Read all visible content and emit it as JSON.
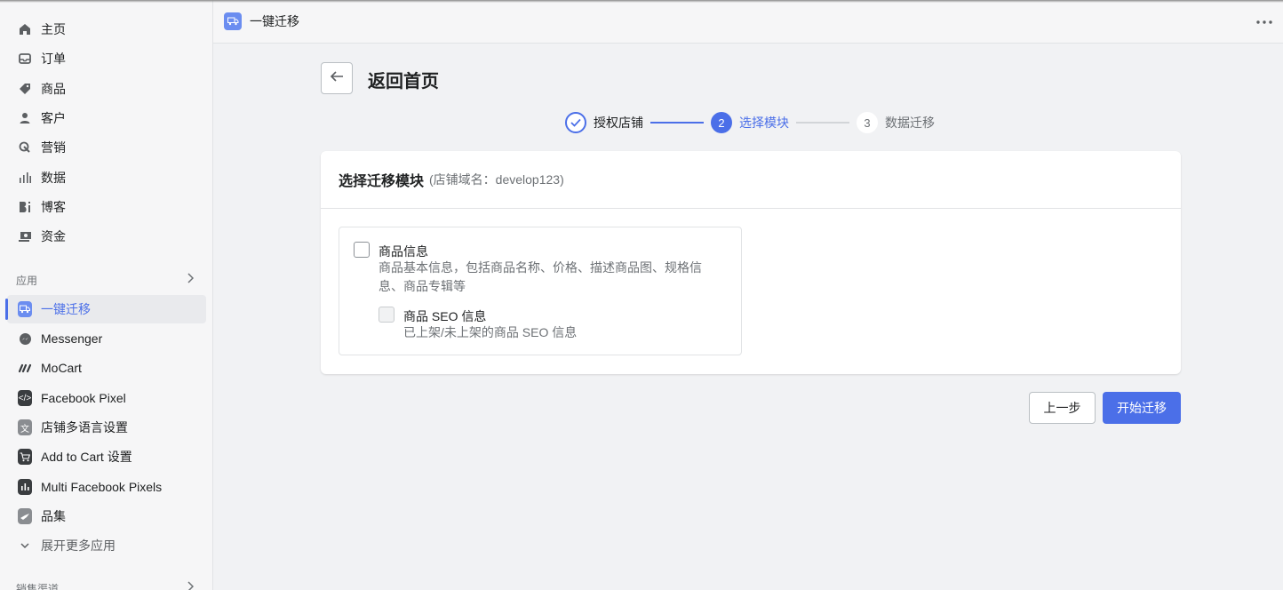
{
  "sidebar": {
    "nav": [
      {
        "label": "主页",
        "icon": "home-icon"
      },
      {
        "label": "订单",
        "icon": "inbox-icon"
      },
      {
        "label": "商品",
        "icon": "tag-icon"
      },
      {
        "label": "客户",
        "icon": "person-icon"
      },
      {
        "label": "营销",
        "icon": "marketing-icon"
      },
      {
        "label": "数据",
        "icon": "bar-chart-icon"
      },
      {
        "label": "博客",
        "icon": "blog-icon"
      },
      {
        "label": "资金",
        "icon": "money-icon"
      }
    ],
    "apps_section_label": "应用",
    "apps": [
      {
        "label": "一键迁移",
        "icon": "migration-truck-icon",
        "active": true
      },
      {
        "label": "Messenger",
        "icon": "messenger-icon"
      },
      {
        "label": "MoCart",
        "icon": "mocart-icon"
      },
      {
        "label": "Facebook Pixel",
        "icon": "code-icon"
      },
      {
        "label": "店铺多语言设置",
        "icon": "translate-icon"
      },
      {
        "label": "Add to Cart 设置",
        "icon": "cart-icon"
      },
      {
        "label": "Multi Facebook Pixels",
        "icon": "chart-icon"
      },
      {
        "label": "品集",
        "icon": "bird-icon"
      }
    ],
    "expand_more_label": "展开更多应用",
    "sales_section_label": "销售渠道"
  },
  "topbar": {
    "title": "一键迁移",
    "more_icon": "more-icon"
  },
  "header": {
    "back_icon": "arrow-left-icon",
    "title": "返回首页"
  },
  "stepper": {
    "steps": [
      {
        "label": "授权店铺",
        "status": "done"
      },
      {
        "number": "2",
        "label": "选择模块",
        "status": "current"
      },
      {
        "number": "3",
        "label": "数据迁移",
        "status": "todo"
      }
    ],
    "accent_color": "#4b6fe8"
  },
  "card": {
    "title": "选择迁移模块",
    "subtitle": "(店铺域名：develop123)",
    "options": [
      {
        "title": "商品信息",
        "description_line1": "商品基本信息，包括商品名称、价格、描述商品图、规格信",
        "description_line2": "息、商品专辑等",
        "checked": false
      },
      {
        "title": "商品 SEO 信息",
        "description": "已上架/未上架的商品 SEO 信息",
        "checked": false,
        "disabled": true
      }
    ]
  },
  "actions": {
    "prev_label": "上一步",
    "start_label": "开始迁移"
  }
}
